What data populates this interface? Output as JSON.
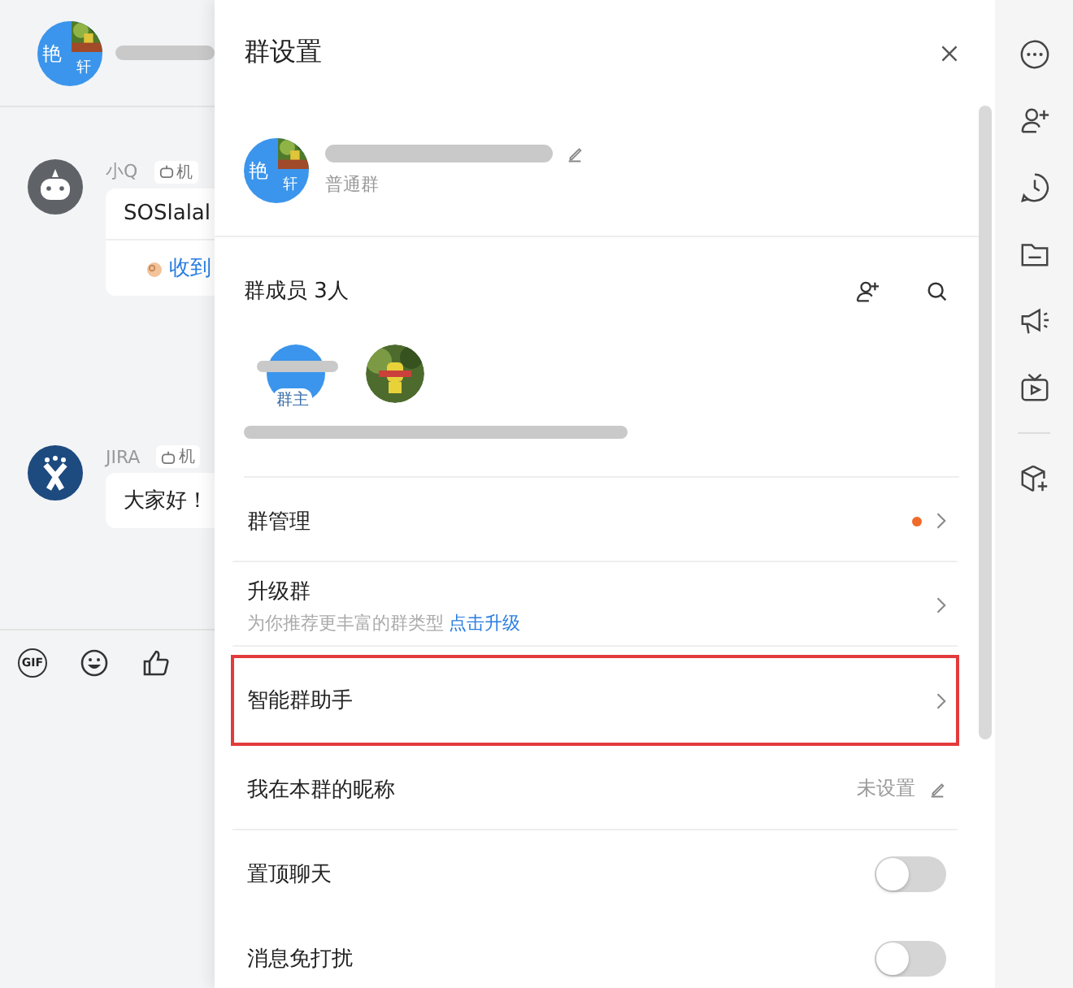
{
  "chat": {
    "header": {
      "avatar_chars": [
        "艳",
        "轩"
      ]
    },
    "messages": [
      {
        "kind": "robot",
        "sender": "小Q",
        "badge": "机",
        "text": "SOSlalal",
        "action": "收到"
      },
      {
        "kind": "jira",
        "sender": "JIRA",
        "badge": "机",
        "text": "大家好！"
      }
    ],
    "toolbar": {
      "gif_label": "GIF"
    }
  },
  "drawer": {
    "title": "群设置",
    "group": {
      "avatar_chars": [
        "艳",
        "轩"
      ],
      "type": "普通群"
    },
    "members": {
      "title": "群成员 3人",
      "owner_badge": "群主"
    },
    "rows": [
      {
        "kind": "link",
        "label": "群管理",
        "unread": true,
        "highlighted": false
      },
      {
        "kind": "link",
        "label": "升级群",
        "subtitle": "为你推荐更丰富的群类型",
        "link": "点击升级",
        "unread": false,
        "highlighted": false
      },
      {
        "kind": "link",
        "label": "智能群助手",
        "unread": false,
        "highlighted": true
      },
      {
        "kind": "value",
        "label": "我在本群的昵称",
        "value": "未设置",
        "unread": false,
        "highlighted": false
      },
      {
        "kind": "toggle",
        "label": "置顶聊天",
        "on": false,
        "unread": false,
        "highlighted": false
      },
      {
        "kind": "toggle",
        "label": "消息免打扰",
        "on": false,
        "unread": false,
        "highlighted": false
      }
    ]
  }
}
